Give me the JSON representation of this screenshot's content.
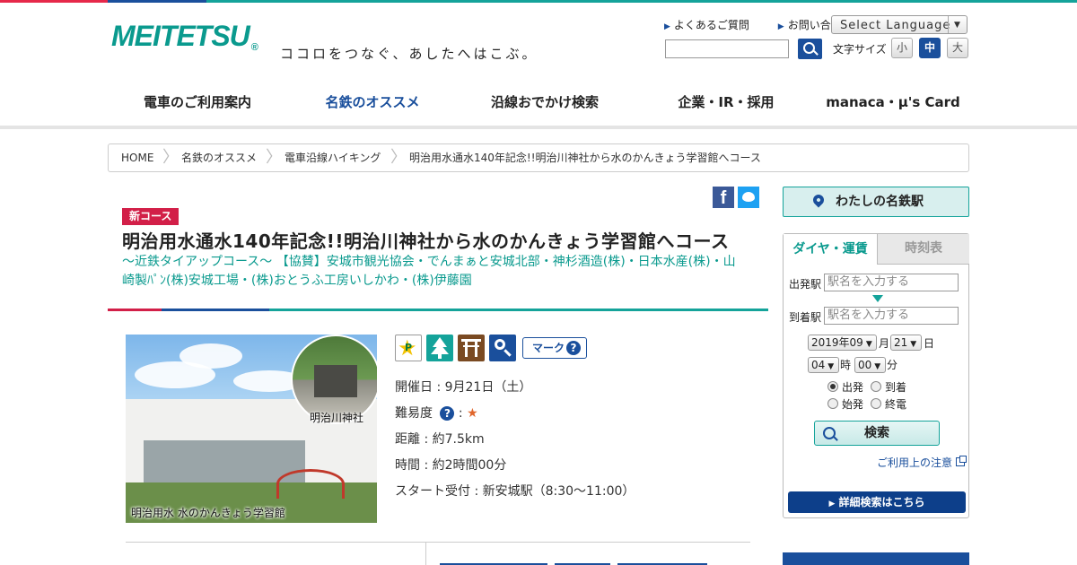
{
  "header": {
    "logo_text": "MEITETSU",
    "logo_mark": "®",
    "tagline": "ココロをつなぐ、あしたへはこぶ。",
    "links": [
      "よくあるご質問",
      "お問い合わせ"
    ],
    "language_select": "Select Language",
    "search_placeholder": "",
    "font_size_label": "文字サイズ",
    "font_sizes": [
      "小",
      "中",
      "大"
    ],
    "font_size_selected": "中"
  },
  "nav": {
    "items": [
      "電車のご利用案内",
      "名鉄のオススメ",
      "沿線おでかけ検索",
      "企業・IR・採用",
      "manaca・μ's Card"
    ],
    "active": "名鉄のオススメ"
  },
  "breadcrumb": [
    "HOME",
    "名鉄のオススメ",
    "電車沿線ハイキング",
    "明治用水通水140年記念!!明治川神社から水のかんきょう学習館へコース"
  ],
  "course": {
    "badge": "新コース",
    "title": "明治用水通水140年記念!!明治川神社から水のかんきょう学習館へコース",
    "subtitle": "～近鉄タイアップコース～ 【協賛】安城市観光協会・でんまぁと安城北部・神杉酒造(株)・日本水産(株)・山崎製ﾊﾟﾝ(株)安城工場・(株)おとうふ工房いしかわ・(株)伊藤園",
    "photo_label": "明治用水 水のかんきょう学習館",
    "inset_label": "明治川神社",
    "mark_button": "マーク",
    "icons": [
      "parking-icon",
      "nature-icon",
      "shrine-icon",
      "search-icon"
    ],
    "date": "開催日 : 9月21日（土）",
    "difficulty_label": "難易度",
    "difficulty_stars": "★",
    "difficulty_value": 1,
    "distance": "距離 : 約7.5km",
    "duration": "時間 : 約2時間00分",
    "start": "スタート受付 : 新安城駅（8:30～11:00）"
  },
  "social": {
    "facebook": "f",
    "twitter": "twitter"
  },
  "sidebar": {
    "my_station": "わたしの名鉄駅",
    "tabs": [
      "ダイヤ・運賃",
      "時刻表"
    ],
    "depart_label": "出発駅",
    "arrive_label": "到着駅",
    "station_placeholder": "駅名を入力する",
    "year_month": "2019年09",
    "month_unit": "月",
    "day": "21",
    "day_unit": "日",
    "hour": "04",
    "hour_unit": "時",
    "minute": "00",
    "minute_unit": "分",
    "options": [
      "出発",
      "到着",
      "始発",
      "終電"
    ],
    "selected_option": "出発",
    "search_button": "検索",
    "notice_link": "ご利用上の注意",
    "detail_button": "詳細検索はこちら"
  },
  "colors": {
    "brand_teal": "#14a39a",
    "brand_blue": "#1a4f9c",
    "brand_red": "#d21f48",
    "star": "#e0662b"
  }
}
